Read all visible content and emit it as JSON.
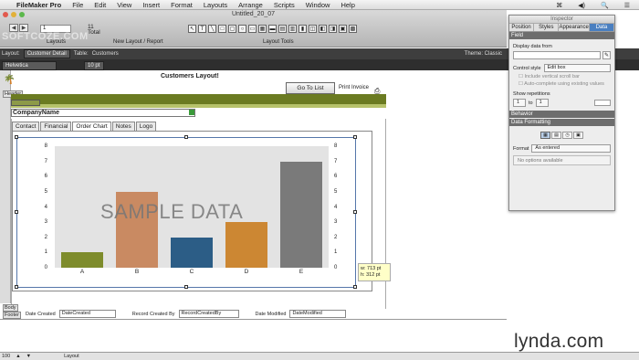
{
  "menubar": {
    "app": "FileMaker Pro",
    "items": [
      "File",
      "Edit",
      "View",
      "Insert",
      "Format",
      "Layouts",
      "Arrange",
      "Scripts",
      "Window",
      "Help"
    ],
    "right": [
      "⌘",
      "◀)",
      "🔍",
      "☰"
    ]
  },
  "window": {
    "title": "Untitled_20_07"
  },
  "toolbar": {
    "record_value": "1",
    "total_count": "11",
    "total_label": "Total",
    "layouts_label": "Layouts",
    "new_layout_label": "New Layout / Report",
    "layout_tools_label": "Layout Tools",
    "manage_label": "nage",
    "watermark": "SOFTCOZE.COM"
  },
  "layoutbar": {
    "layout_label": "Layout:",
    "layout_value": "Customer Detail",
    "table_label": "Table:",
    "table_value": "Customers",
    "theme_label": "Theme: Classic",
    "font_value": "Helvetica",
    "size_value": "10 pt"
  },
  "layout": {
    "title": "Customers Layout!",
    "goto_list": "Go To List",
    "print_invoice": "Print Invoice",
    "company_field": "CompanyName",
    "header_label": "Header",
    "body_label": "Body",
    "footer_label": "Footer"
  },
  "tabs": [
    {
      "label": "Contact"
    },
    {
      "label": "Financial"
    },
    {
      "label": "Order Chart",
      "active": true
    },
    {
      "label": "Notes"
    },
    {
      "label": "Logo"
    }
  ],
  "chart_data": {
    "type": "bar",
    "categories": [
      "A",
      "B",
      "C",
      "D",
      "E"
    ],
    "values": [
      1,
      5,
      2,
      3,
      7
    ],
    "colors": [
      "#7e8c2c",
      "#c98a62",
      "#2c5d86",
      "#cc8733",
      "#7a7a7a"
    ],
    "ylim": [
      0,
      8
    ],
    "yticks": [
      0,
      1,
      2,
      3,
      4,
      5,
      6,
      7,
      8
    ],
    "watermark": "SAMPLE DATA"
  },
  "footer": {
    "date_created_label": "Date Created",
    "date_created_field": "DateCreated",
    "record_by_label": "Record Created By",
    "record_by_field": "RecordCreatedBy",
    "date_modified_label": "Date Modified",
    "date_modified_field": "DateModified"
  },
  "sizetip": {
    "w": "w: 713 pt",
    "h": "h: 312 pt"
  },
  "inspector": {
    "title": "Inspector",
    "tabs": [
      "Position",
      "Styles",
      "Appearance",
      "Data"
    ],
    "active_tab": "Data",
    "field_section": "Field",
    "display_data_from": "Display data from",
    "control_style_label": "Control style",
    "control_style_value": "Edit box",
    "vertical_scroll": "Include vertical scroll bar",
    "autocomplete": "Auto-complete using existing values",
    "show_repetitions": "Show repetitions",
    "rep_from": "1",
    "rep_to_label": "to",
    "rep_to": "1",
    "behavior_section": "Behavior",
    "data_formatting_section": "Data Formatting",
    "format_label": "Format",
    "format_value": "As entered",
    "no_options": "No options available"
  },
  "statusbar": {
    "zoom": "100",
    "mode": "Layout"
  },
  "brand": {
    "lynda": "lynda.com"
  }
}
